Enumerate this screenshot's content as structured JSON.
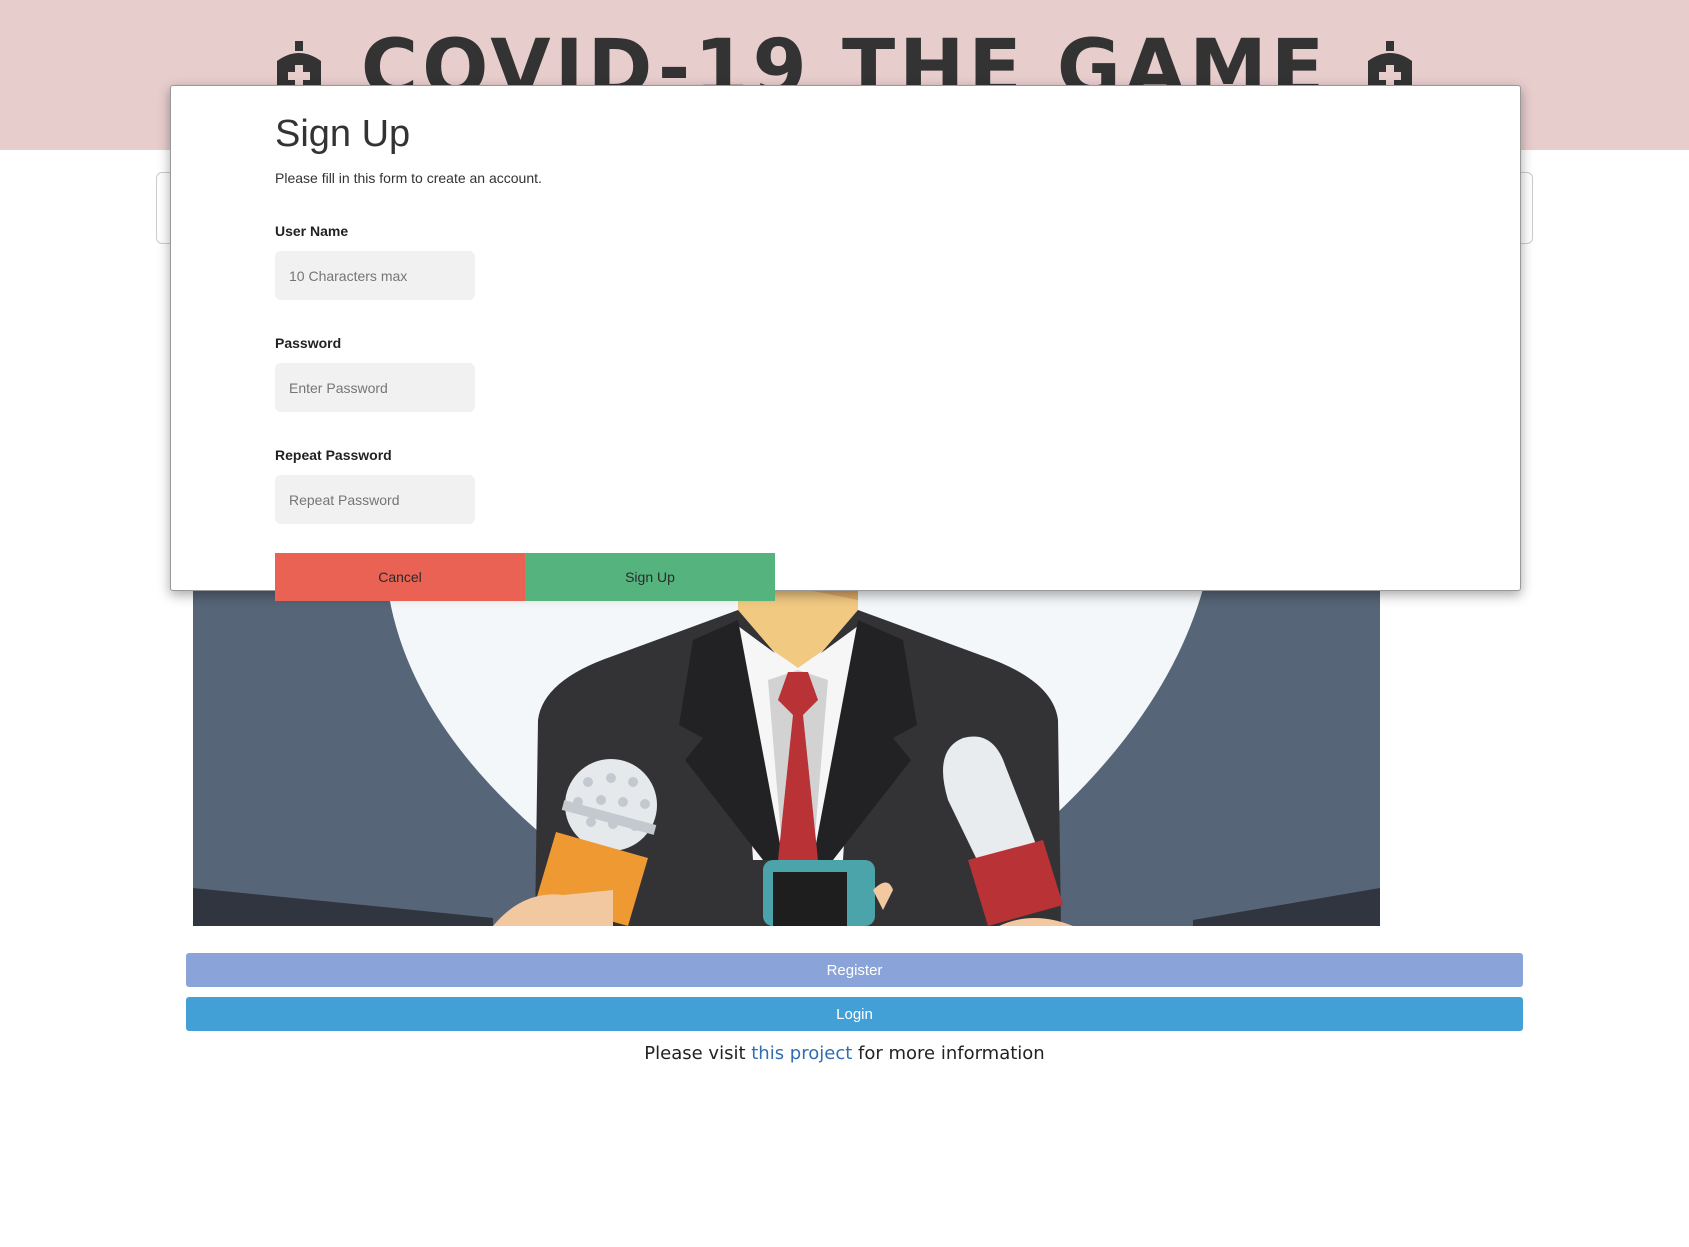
{
  "header": {
    "title": "COVID-19 THE GAME",
    "icon": "coronavirus-medical-icon"
  },
  "modal": {
    "title": "Sign Up",
    "subtitle": "Please fill in this form to create an account.",
    "fields": [
      {
        "label": "User Name",
        "placeholder": "10 Characters max",
        "value": ""
      },
      {
        "label": "Password",
        "placeholder": "Enter Password",
        "value": ""
      },
      {
        "label": "Repeat Password",
        "placeholder": "Repeat Password",
        "value": ""
      }
    ],
    "cancel_label": "Cancel",
    "signup_label": "Sign Up"
  },
  "actions": {
    "register_label": "Register",
    "login_label": "Login"
  },
  "footer": {
    "prefix": "Please visit ",
    "link_text": "this project",
    "suffix": " for more information"
  },
  "colors": {
    "header_bg": "#e8cdcd",
    "cancel": "#e96253",
    "signup": "#55b47e",
    "register": "#8aa4d9",
    "login": "#43a0d6",
    "link": "#2f6db5"
  }
}
